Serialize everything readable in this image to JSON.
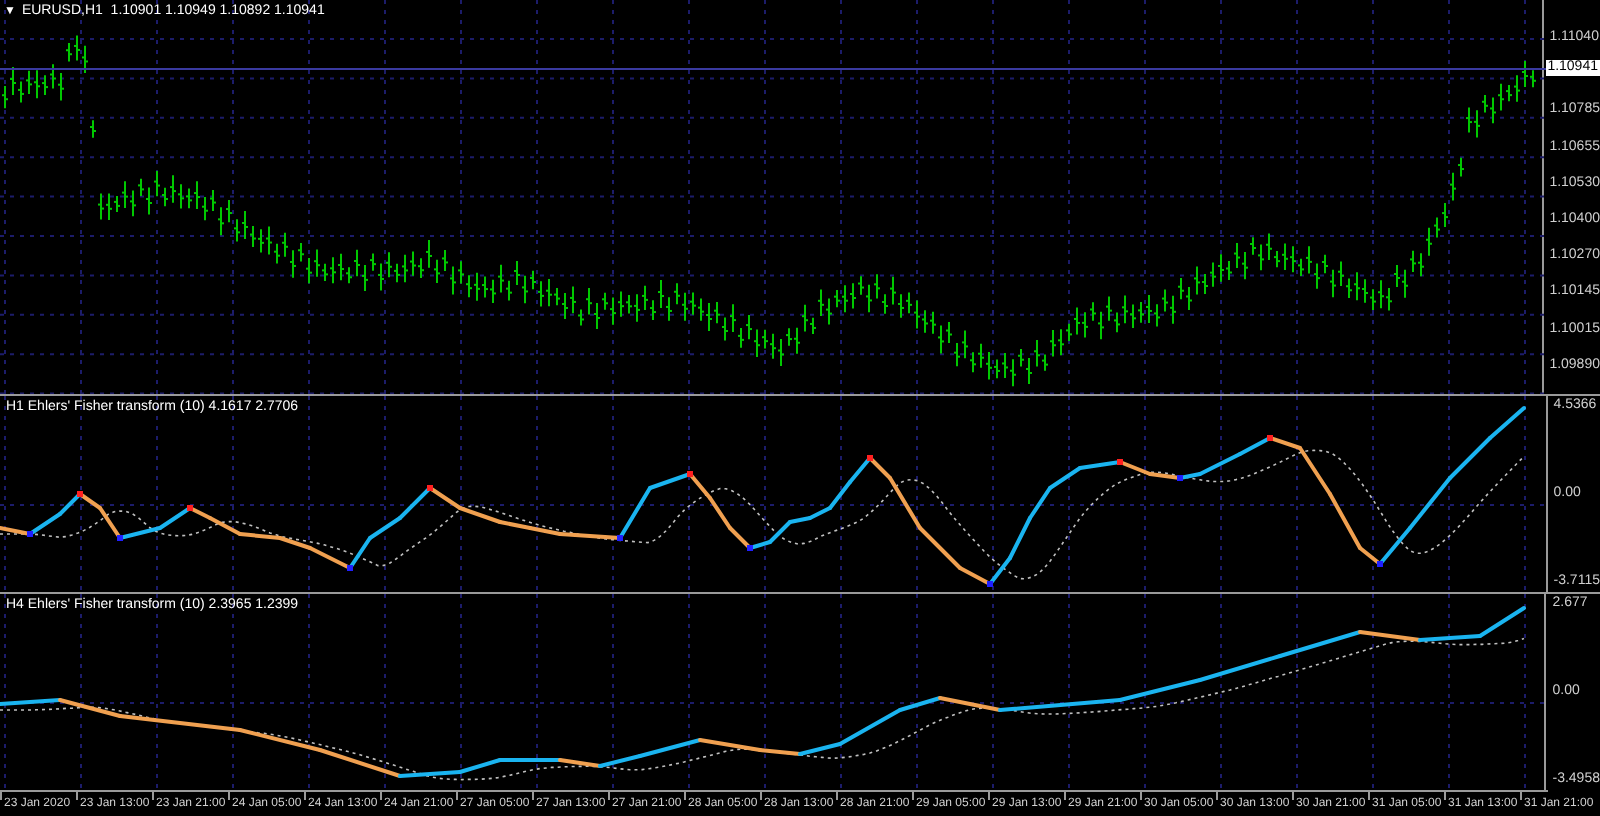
{
  "main_chart": {
    "title_arrow": "▼",
    "title": "EURUSD,H1  1.10901 1.10949 1.10892 1.10941",
    "price_labels": [
      "1.11040",
      "1.10785",
      "1.10655",
      "1.10530",
      "1.10400",
      "1.10270",
      "1.10145",
      "1.10015",
      "1.09890"
    ],
    "current_price": "1.10941"
  },
  "indicator_panes": [
    {
      "title": "H1 Ehlers' Fisher transform (10) 4.1617 2.7706",
      "axis_labels": [
        "4.5366",
        "0.00",
        "-3.7115"
      ]
    },
    {
      "title": "H4 Ehlers' Fisher transform (10) 2.3965 1.2399",
      "axis_labels": [
        "2.677",
        "0.00",
        "-3.4958"
      ]
    }
  ],
  "time_axis": [
    "23 Jan 2020",
    "23 Jan 13:00",
    "23 Jan 21:00",
    "24 Jan 05:00",
    "24 Jan 13:00",
    "24 Jan 21:00",
    "27 Jan 05:00",
    "27 Jan 13:00",
    "27 Jan 21:00",
    "28 Jan 05:00",
    "28 Jan 13:00",
    "28 Jan 21:00",
    "29 Jan 05:00",
    "29 Jan 13:00",
    "29 Jan 21:00",
    "30 Jan 05:00",
    "30 Jan 13:00",
    "30 Jan 21:00",
    "31 Jan 05:00",
    "31 Jan 13:00",
    "31 Jan 21:00"
  ]
}
